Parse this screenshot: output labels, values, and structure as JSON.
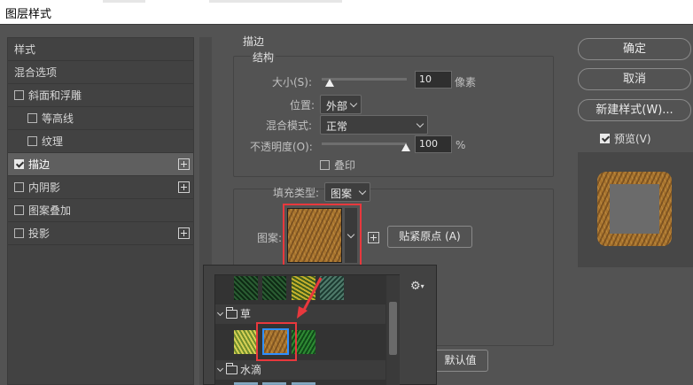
{
  "window": {
    "title": "图层样式"
  },
  "styles_list": [
    {
      "label": "样式",
      "checkbox": false,
      "checked": false,
      "plus": false,
      "indent": false,
      "selected": false
    },
    {
      "label": "混合选项",
      "checkbox": false,
      "checked": false,
      "plus": false,
      "indent": false,
      "selected": false
    },
    {
      "label": "斜面和浮雕",
      "checkbox": true,
      "checked": false,
      "plus": false,
      "indent": false,
      "selected": false
    },
    {
      "label": "等高线",
      "checkbox": true,
      "checked": false,
      "plus": false,
      "indent": true,
      "selected": false
    },
    {
      "label": "纹理",
      "checkbox": true,
      "checked": false,
      "plus": false,
      "indent": true,
      "selected": false
    },
    {
      "label": "描边",
      "checkbox": true,
      "checked": true,
      "plus": true,
      "indent": false,
      "selected": true
    },
    {
      "label": "内阴影",
      "checkbox": true,
      "checked": false,
      "plus": true,
      "indent": false,
      "selected": false
    },
    {
      "label": "图案叠加",
      "checkbox": true,
      "checked": false,
      "plus": false,
      "indent": false,
      "selected": false
    },
    {
      "label": "投影",
      "checkbox": true,
      "checked": false,
      "plus": true,
      "indent": false,
      "selected": false
    }
  ],
  "stroke": {
    "section_title": "描边",
    "structure_title": "结构",
    "size_label": "大小(S):",
    "size_value": "10",
    "size_unit": "像素",
    "position_label": "位置:",
    "position_value": "外部",
    "blend_label": "混合模式:",
    "blend_value": "正常",
    "opacity_label": "不透明度(O):",
    "opacity_value": "100",
    "opacity_unit": "%",
    "overprint_label": "叠印",
    "fill_type_label": "填充类型:",
    "fill_type_value": "图案",
    "pattern_label": "图案:",
    "snap_origin_label": "贴紧原点 (A)",
    "reset_default_label": "默认值"
  },
  "buttons": {
    "ok": "确定",
    "cancel": "取消",
    "new_style": "新建样式(W)...",
    "preview_label": "预览(V)"
  },
  "pattern_picker": {
    "folders": [
      {
        "name": "草"
      },
      {
        "name": "水滴"
      }
    ]
  },
  "colors": {
    "accent_red": "#e8383d",
    "selection_blue": "#2f8fff"
  }
}
